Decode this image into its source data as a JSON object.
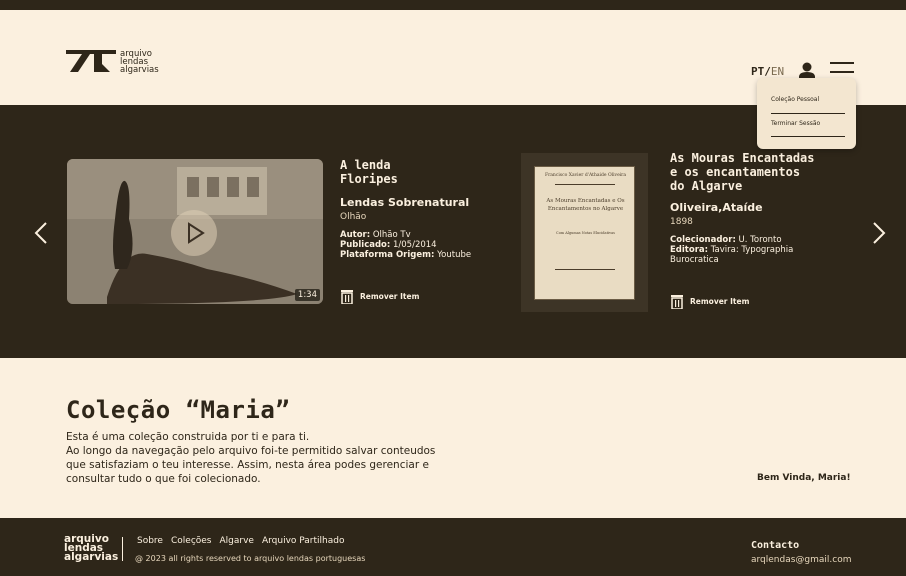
{
  "header": {
    "logo_lines": [
      "arquivo",
      "lendas",
      "algarvias"
    ],
    "lang_pt": "PT",
    "lang_sep": "/",
    "lang_en": "EN",
    "user_icon": "user-icon",
    "menu_icon": "hamburger-menu-icon"
  },
  "dropdown": {
    "items": [
      "Coleção Pessoal",
      "Terminar Sessão"
    ]
  },
  "carousel": {
    "items": [
      {
        "title": "A lenda Floripes",
        "subtitle": "Lendas Sobrenatural",
        "location": "Olhão",
        "meta": [
          {
            "label": "Autor:",
            "value": " Olhão Tv"
          },
          {
            "label": "Publicado:",
            "value": " 1/05/2014"
          },
          {
            "label": "Plataforma Origem:",
            "value": " Youtube"
          }
        ],
        "duration": "1:34",
        "remove_label": "Remover Item"
      },
      {
        "title": "As Mouras Encantadas e os encantamentos do Algarve",
        "author": "Oliveira,Ataíde",
        "year": "1898",
        "meta": [
          {
            "label": "Colecionador:",
            "value": " U. Toronto"
          },
          {
            "label": "Editora:",
            "value": " Tavira: Typographia Burocratica"
          }
        ],
        "book_top": "Francisco Xavier d'Athaide Oliveira",
        "book_title": "As Mouras Encantadas e Os Encantamentos no Algarve",
        "book_subtitle": "Com Algumas Notas Elucidativas",
        "book_footer": "Forgotten Books",
        "remove_label": "Remover Item"
      }
    ]
  },
  "collection": {
    "title": "Coleção “Maria”",
    "desc1": "Esta é uma coleção construida por ti  e para ti.",
    "desc2": "Ao longo da navegação pelo arquivo foi-te permitido salvar conteudos que satisfaziam o teu interesse. Assim, nesta área podes gerenciar e consultar tudo o que foi colecionado.",
    "welcome": "Bem Vinda, Maria!"
  },
  "footer": {
    "logo_lines": [
      "arquivo",
      "lendas",
      "algarvias"
    ],
    "links": [
      "Sobre",
      "Coleções",
      "Algarve",
      "Arquivo Partilhado"
    ],
    "copyright": "@ 2023 all rights reserved to arquivo lendas portuguesas",
    "contact_title": "Contacto",
    "email": "arqlendas@gmail.com"
  }
}
